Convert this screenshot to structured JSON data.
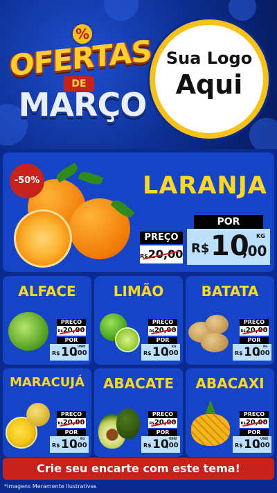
{
  "header": {
    "percent_badge": "%",
    "title_line1": "OFERTAS",
    "title_line2": "DE",
    "title_line3": "MARÇO",
    "logo_line1": "Sua Logo",
    "logo_line2": "Aqui"
  },
  "featured": {
    "discount_badge": "-50%",
    "name": "LARANJA",
    "preco_label": "PREÇO",
    "old_currency": "R$",
    "old_price": "20,00",
    "por_label": "POR",
    "currency": "R$",
    "price_int": "10",
    "price_dec": ",00",
    "unit": "KG"
  },
  "products": [
    {
      "name": "ALFACE",
      "preco_label": "PREÇO",
      "old_currency": "R$",
      "old_price": "20,00",
      "por_label": "POR",
      "currency": "R$",
      "price_int": "10",
      "price_dec": ",00",
      "unit": "UNID"
    },
    {
      "name": "LIMÃO",
      "preco_label": "PREÇO",
      "old_currency": "R$",
      "old_price": "20,00",
      "por_label": "POR",
      "currency": "R$",
      "price_int": "10",
      "price_dec": ",00",
      "unit": "KG"
    },
    {
      "name": "BATATA",
      "preco_label": "PREÇO",
      "old_currency": "R$",
      "old_price": "20,00",
      "por_label": "POR",
      "currency": "R$",
      "price_int": "10",
      "price_dec": ",00",
      "unit": "KG"
    },
    {
      "name": "MARACUJÁ",
      "preco_label": "PREÇO",
      "old_currency": "R$",
      "old_price": "20,00",
      "por_label": "POR",
      "currency": "R$",
      "price_int": "10",
      "price_dec": ",00",
      "unit": "KG"
    },
    {
      "name": "ABACATE",
      "preco_label": "PREÇO",
      "old_currency": "R$",
      "old_price": "20,00",
      "por_label": "POR",
      "currency": "R$",
      "price_int": "10",
      "price_dec": ",00",
      "unit": "UNID"
    },
    {
      "name": "ABACAXI",
      "preco_label": "PREÇO",
      "old_currency": "R$",
      "old_price": "20,00",
      "por_label": "POR",
      "currency": "R$",
      "price_int": "10",
      "price_dec": ",00",
      "unit": "UNID"
    }
  ],
  "cta": "Crie seu encarte com este tema!",
  "disclaimer": "*Imagens Meramente Ilustrativas",
  "colors": {
    "background": "#0b2a8f",
    "card": "#1545c6",
    "title_yellow": "#ffd81f",
    "accent_red": "#c7231c",
    "price_box": "#bde0ff",
    "logo_ring": "#f6c21a"
  }
}
